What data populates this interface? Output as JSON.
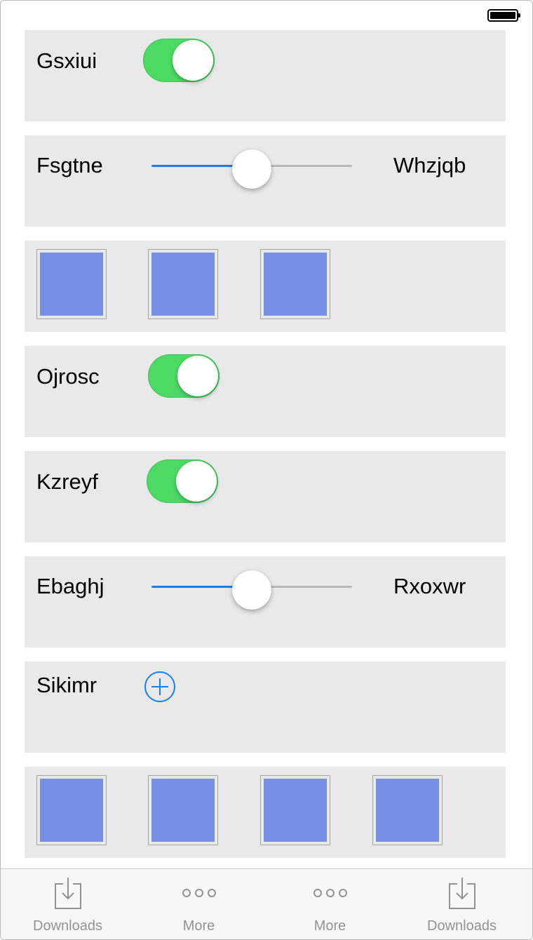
{
  "status_bar": {
    "battery": "full"
  },
  "rows": {
    "gsxiui": {
      "label": "Gsxiui",
      "toggle_on": true
    },
    "fsgtne": {
      "left_label": "Fsgtne",
      "right_label": "Whzjqb",
      "slider_value": 0.5
    },
    "ojrosc": {
      "label": "Ojrosc",
      "toggle_on": true
    },
    "kzreyf": {
      "label": "Kzreyf",
      "toggle_on": true
    },
    "ebaghj": {
      "left_label": "Ebaghj",
      "right_label": "Rxoxwr",
      "slider_value": 0.5
    },
    "sikimr": {
      "label": "Sikimr",
      "action_icon": "plus-circle-icon"
    }
  },
  "tile_grids": [
    {
      "count": 3
    },
    {
      "count": 4
    }
  ],
  "tab_bar": {
    "items": [
      {
        "label": "Downloads",
        "icon": "download-icon"
      },
      {
        "label": "More",
        "icon": "more-icon"
      },
      {
        "label": "More",
        "icon": "more-icon"
      },
      {
        "label": "Downloads",
        "icon": "download-icon"
      }
    ]
  },
  "colors": {
    "row_background": "#e9e9e9",
    "toggle_on": "#4cd964",
    "accent": "#1b7cf0",
    "tile_fill": "#758fe4",
    "tab_label": "#929292"
  }
}
